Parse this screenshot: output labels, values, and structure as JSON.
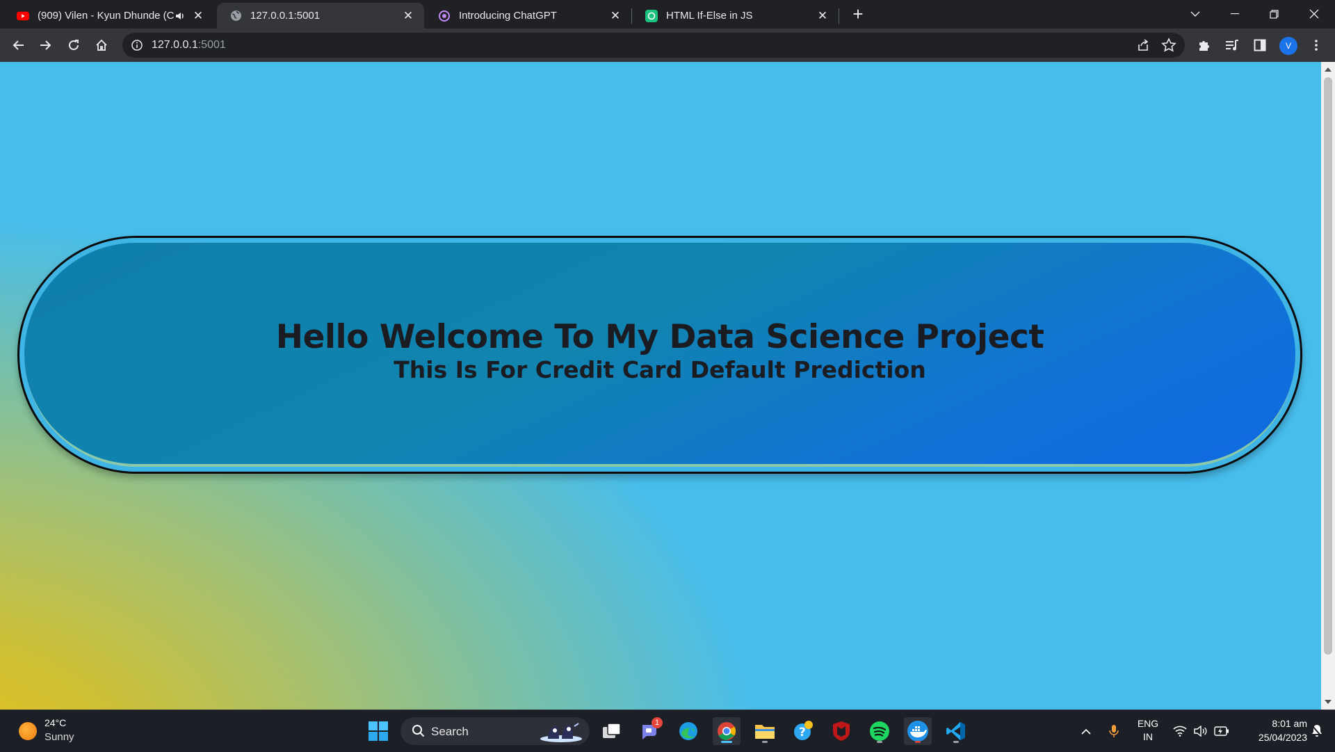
{
  "browser": {
    "tabs": [
      {
        "title": "(909) Vilen - Kyun Dhunde (C",
        "favicon": "youtube-icon",
        "audio": true,
        "active": false
      },
      {
        "title": "127.0.0.1:5001",
        "favicon": "globe-icon",
        "active": true
      },
      {
        "title": "Introducing ChatGPT",
        "favicon": "openai-icon",
        "active": false
      },
      {
        "title": "HTML If-Else in JS",
        "favicon": "chatgpt-icon",
        "active": false
      }
    ],
    "url": {
      "host": "127.0.0.1",
      "port": ":5001"
    },
    "profile_initial": "V"
  },
  "page": {
    "title": "Hello Welcome To My Data Science Project",
    "subtitle": "This Is For Credit Card Default Prediction"
  },
  "taskbar": {
    "weather": {
      "temp": "24°C",
      "condition": "Sunny"
    },
    "search_label": "Search",
    "chat_badge": "1",
    "language": {
      "line1": "ENG",
      "line2": "IN"
    },
    "clock": {
      "time": "8:01 am",
      "date": "25/04/2023"
    }
  },
  "colors": {
    "page_bg": "#47bdec",
    "hero": "#1184b0",
    "accent": "#4cc2ff"
  }
}
